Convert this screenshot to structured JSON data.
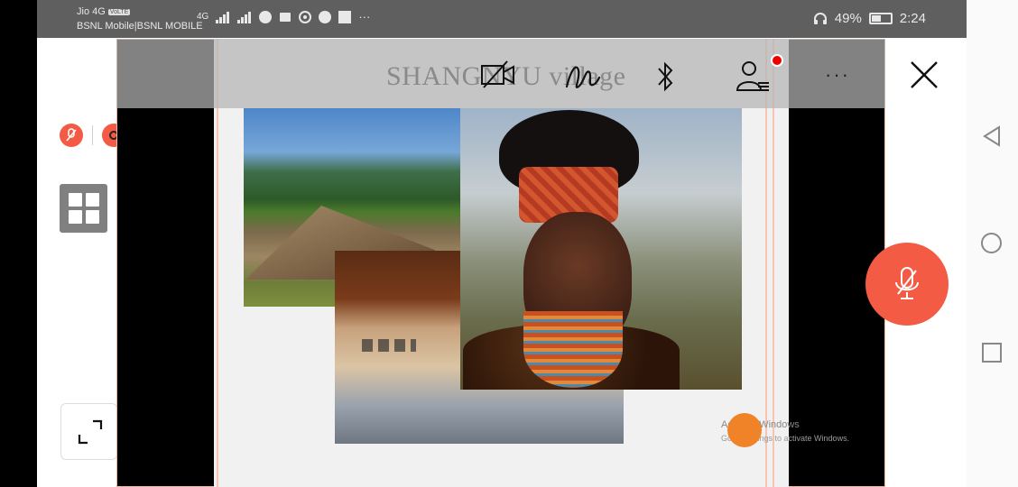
{
  "status_bar": {
    "carrier_line1": "Jio 4G",
    "volte_badge": "VoLTE",
    "carrier_line2": "BSNL Mobile|BSNL MOBILE",
    "network_label": "4G",
    "battery_percent": "49%",
    "time": "2:24",
    "overflow": "···"
  },
  "meeting": {
    "slide_title": "SHANGNYU village",
    "toolbar": {
      "video_icon": "video-off-icon",
      "annotate_icon": "annotate-icon",
      "bluetooth_icon": "bluetooth-icon",
      "participants_icon": "participants-icon",
      "more_label": "···"
    },
    "watermark": {
      "line1": "Activate Windows",
      "line2": "Go to Settings to activate Windows."
    }
  },
  "colors": {
    "accent": "#f35b45",
    "cursor": "#f08328",
    "statusbar": "#5f5f5f"
  }
}
